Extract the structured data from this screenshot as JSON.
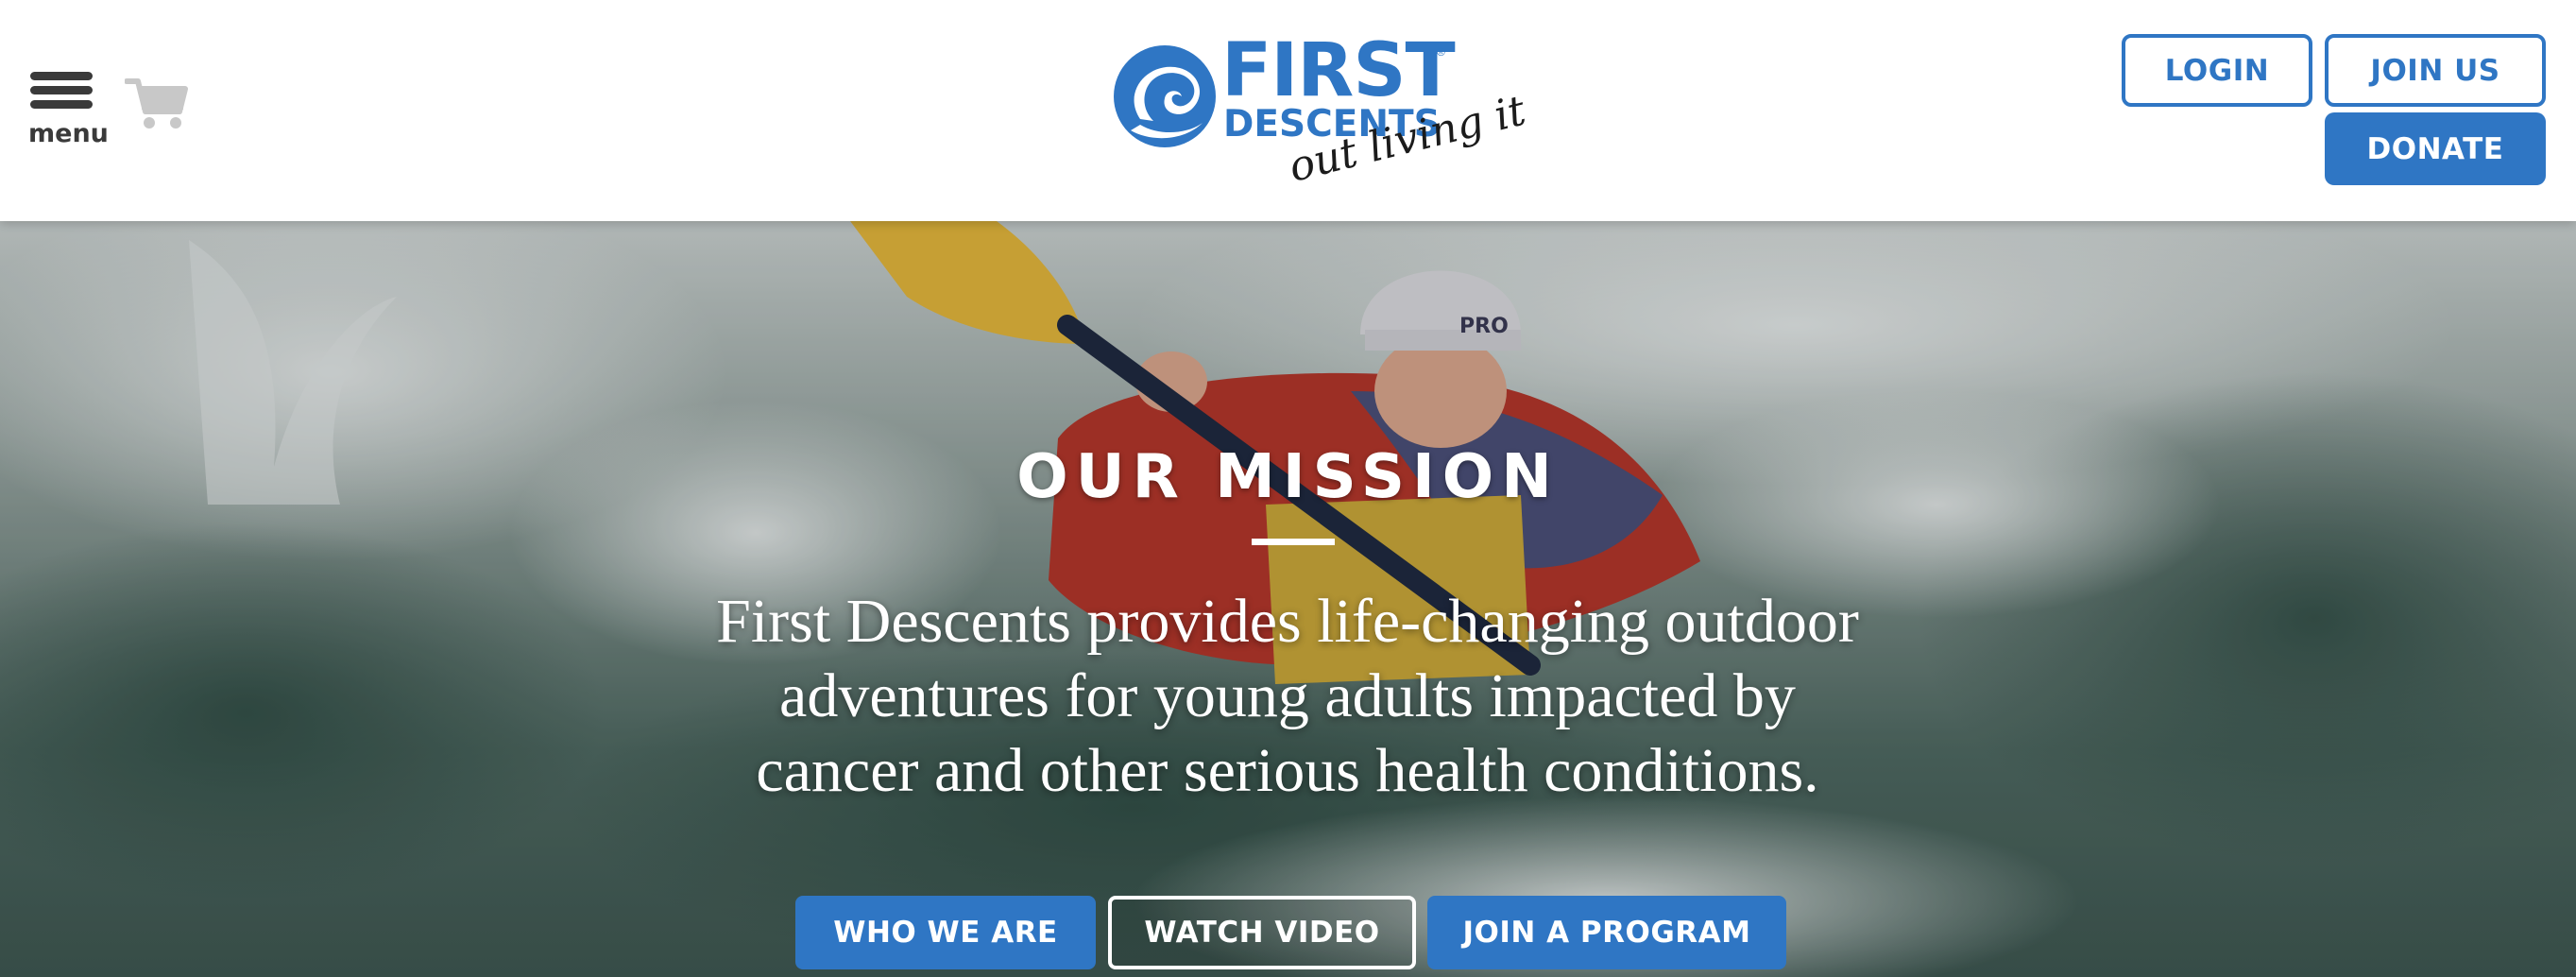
{
  "header": {
    "menu_label": "menu",
    "logo": {
      "word_first": "FIRST",
      "word_descents": "DESCENTS",
      "tagline": "out living it",
      "registered_mark": "®"
    },
    "login_label": "LOGIN",
    "join_us_label": "JOIN US",
    "donate_label": "DONATE"
  },
  "hero": {
    "title": "OUR MISSION",
    "mission_lines": [
      "First Descents provides life-changing outdoor",
      "adventures for young adults impacted by",
      "cancer and other serious health conditions."
    ],
    "buttons": {
      "who_we_are": "WHO WE ARE",
      "watch_video": "WATCH VIDEO",
      "join_program": "JOIN A PROGRAM"
    },
    "helmet_text": "PRO"
  },
  "icons": {
    "menu": "hamburger-menu-icon",
    "cart": "shopping-cart-icon",
    "logo_mark": "wave-swirl-logo-icon"
  },
  "colors": {
    "brand_blue": "#2f76c4",
    "menu_gray": "#3a3a3a",
    "cart_gray": "#c8c8c8",
    "white": "#ffffff"
  }
}
